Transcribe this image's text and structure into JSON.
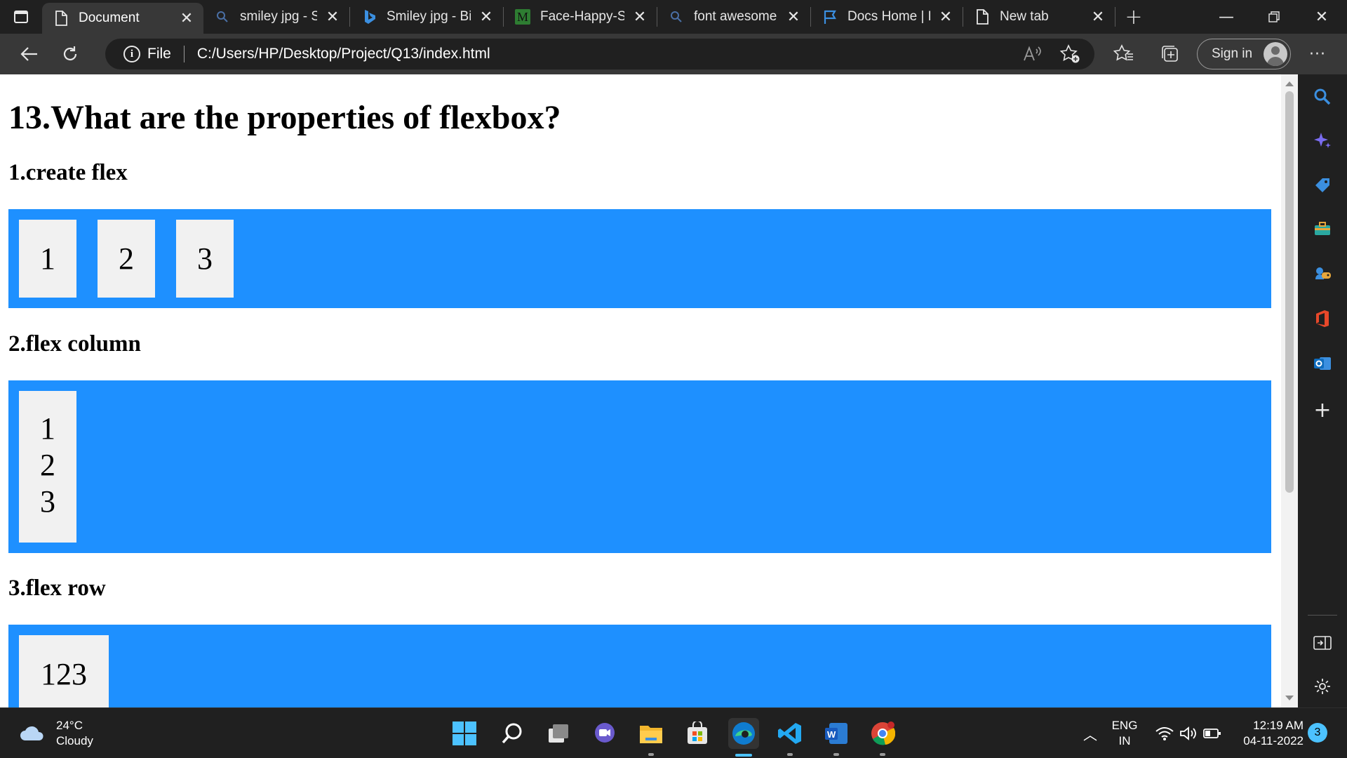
{
  "browser": {
    "tabs": [
      {
        "title": "Document",
        "icon": "page-icon",
        "active": true
      },
      {
        "title": "smiley jpg - Se",
        "icon": "search-icon"
      },
      {
        "title": "Smiley jpg - Bi",
        "icon": "bing-icon"
      },
      {
        "title": "Face-Happy-Sr",
        "icon": "m-logo-icon",
        "favicon_letter": "M"
      },
      {
        "title": "font awesome",
        "icon": "search-icon"
      },
      {
        "title": "Docs Home | F",
        "icon": "flag-icon"
      },
      {
        "title": "New tab",
        "icon": "page-icon"
      }
    ],
    "address": {
      "scheme_label": "File",
      "url": "C:/Users/HP/Desktop/Project/Q13/index.html"
    },
    "signin_label": "Sign in",
    "read_aloud_label": "Â)"
  },
  "page": {
    "heading": "13.What are the properties of flexbox?",
    "sections": [
      {
        "title": "1.create flex",
        "items": [
          "1",
          "2",
          "3"
        ]
      },
      {
        "title": "2.flex column",
        "items": [
          "1",
          "2",
          "3"
        ]
      },
      {
        "title": "3.flex row",
        "items": [
          "123"
        ]
      }
    ],
    "accent_color": "#1e90ff",
    "cell_color": "#f1f1f1"
  },
  "taskbar": {
    "weather": {
      "temp": "24°C",
      "condition": "Cloudy"
    },
    "language": {
      "line1": "ENG",
      "line2": "IN"
    },
    "clock": {
      "time": "12:19 AM",
      "date": "04-11-2022"
    },
    "notification_count": "3"
  }
}
